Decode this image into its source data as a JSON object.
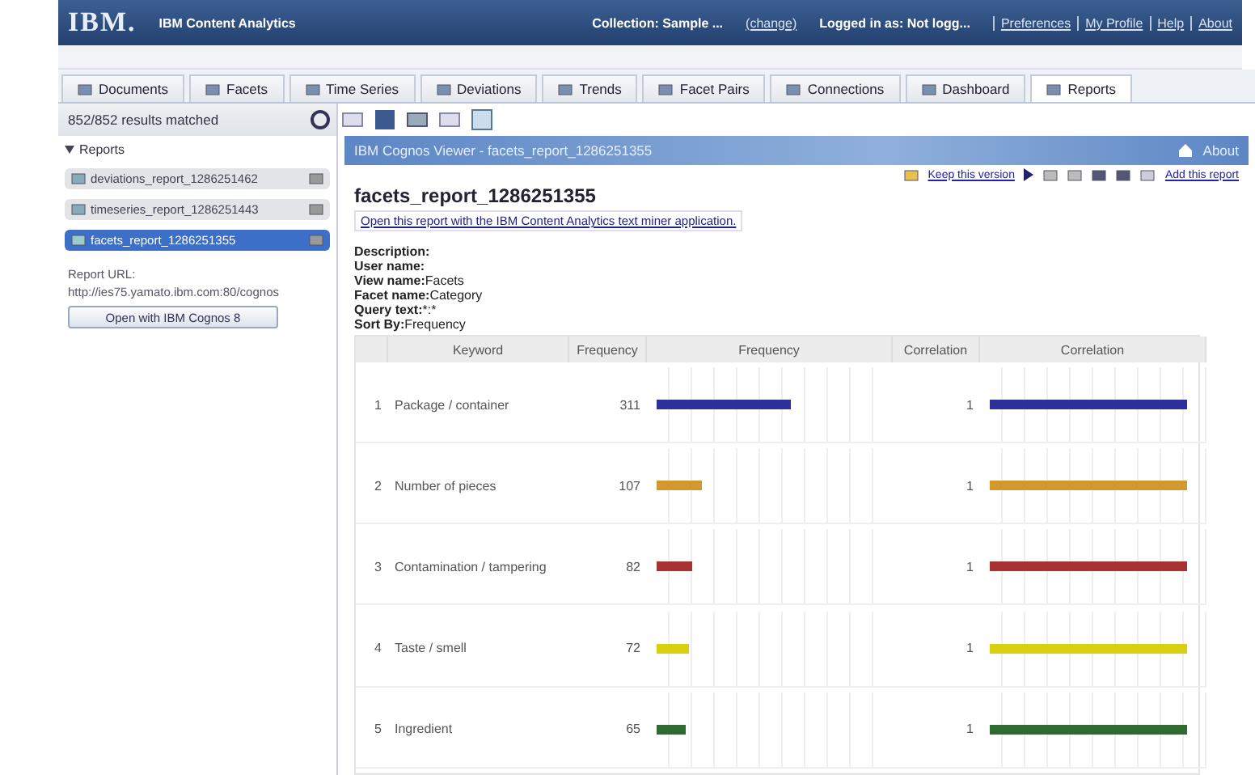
{
  "header": {
    "logo": "IBM.",
    "product": "IBM Content Analytics",
    "collection": "Collection: Sample ...",
    "change_link": "(change)",
    "login": "Logged in as: Not logg...",
    "links": [
      "Preferences",
      "My Profile",
      "Help",
      "About"
    ]
  },
  "tabs": [
    {
      "label": "Documents",
      "selected": false
    },
    {
      "label": "Facets",
      "selected": false
    },
    {
      "label": "Time Series",
      "selected": false
    },
    {
      "label": "Deviations",
      "selected": false
    },
    {
      "label": "Trends",
      "selected": false
    },
    {
      "label": "Facet Pairs",
      "selected": false
    },
    {
      "label": "Connections",
      "selected": false
    },
    {
      "label": "Dashboard",
      "selected": false
    },
    {
      "label": "Reports",
      "selected": true
    }
  ],
  "results": "852/852 results matched",
  "sidebar": {
    "section": "Reports",
    "items": [
      {
        "label": "deviations_report_1286251462",
        "selected": false
      },
      {
        "label": "timeseries_report_1286251443",
        "selected": false
      },
      {
        "label": "facets_report_1286251355",
        "selected": true
      }
    ],
    "url_label": "Report URL:",
    "url": "http://ies75.yamato.ibm.com:80/cognos",
    "open_button": "Open with IBM Cognos 8"
  },
  "viewer": {
    "title": "IBM Cognos Viewer - facets_report_1286251355",
    "about": "About",
    "keep_link": "Keep this version",
    "add_link": "Add this report",
    "report_title": "facets_report_1286251355",
    "open_link": "Open this report with the IBM Content Analytics text miner application.",
    "meta": [
      {
        "label": "Description:"
      },
      {
        "label": "User name:"
      },
      {
        "label": "View name:",
        "value": "Facets"
      },
      {
        "label": "Facet name:",
        "value": "Category"
      },
      {
        "label": "Query text:",
        "value": "*:*"
      },
      {
        "label": "Sort By:",
        "value": "Frequency"
      }
    ],
    "columns": [
      "Keyword",
      "Frequency",
      "Frequency",
      "Correlation",
      "Correlation"
    ],
    "rows": [
      {
        "index": "1",
        "keyword": "Package / container",
        "frequency": "311",
        "frequency_bar": {
          "level": 0.59
        },
        "correlation": "1",
        "correlation_bar": {
          "level": 0.95
        },
        "color": "#2c2f9c"
      },
      {
        "index": "2",
        "keyword": "Number of pieces",
        "frequency": "107",
        "frequency_bar": {
          "level": 0.2
        },
        "correlation": "1",
        "correlation_bar": {
          "level": 0.95
        },
        "color": "#d29a2e"
      },
      {
        "index": "3",
        "keyword": "Contamination / tampering",
        "frequency": "82",
        "frequency_bar": {
          "level": 0.155
        },
        "correlation": "1",
        "correlation_bar": {
          "level": 0.95
        },
        "color": "#a83232"
      },
      {
        "index": "4",
        "keyword": "Taste / smell",
        "frequency": "72",
        "frequency_bar": {
          "level": 0.14
        },
        "correlation": "1",
        "correlation_bar": {
          "level": 0.95
        },
        "color": "#d6d010"
      },
      {
        "index": "5",
        "keyword": "Ingredient",
        "frequency": "65",
        "frequency_bar": {
          "level": 0.125
        },
        "correlation": "1",
        "correlation_bar": {
          "level": 0.95
        },
        "color": "#2f6a30"
      }
    ]
  }
}
